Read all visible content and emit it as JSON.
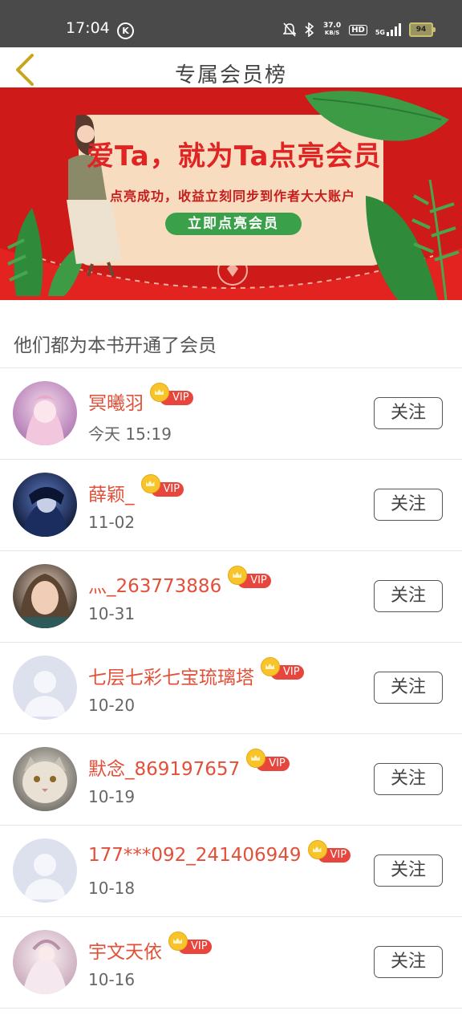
{
  "status_bar": {
    "time": "17:04",
    "k_icon_letter": "K",
    "net_speed_value": "37.0",
    "net_speed_unit": "KB/S",
    "hd_label": "HD",
    "signal_label": "5G",
    "battery": "94"
  },
  "nav": {
    "title": "专属会员榜"
  },
  "banner": {
    "title": "爱Ta，就为Ta点亮会员",
    "subtitle": "点亮成功，收益立刻同步到作者大大账户",
    "button": "立即点亮会员"
  },
  "section_title": "他们都为本书开通了会员",
  "members": [
    {
      "name": "冥曦羽",
      "date": "今天 15:19",
      "badge": "VIP",
      "follow": "关注",
      "avatar": "anime-pink"
    },
    {
      "name": "薛颖_",
      "date": "11-02",
      "badge": "VIP",
      "follow": "关注",
      "avatar": "anime-dark-blue"
    },
    {
      "name": "灬_263773886",
      "date": "10-31",
      "badge": "VIP",
      "follow": "关注",
      "avatar": "photo-girl"
    },
    {
      "name": "七层七彩七宝琉璃塔",
      "date": "10-20",
      "badge": "VIP",
      "follow": "关注",
      "avatar": "default-person"
    },
    {
      "name": "默念_869197657",
      "date": "10-19",
      "badge": "VIP",
      "follow": "关注",
      "avatar": "photo-cat"
    },
    {
      "name": "177***092_241406949",
      "date": "10-18",
      "badge": "VIP",
      "follow": "关注",
      "avatar": "default-person"
    },
    {
      "name": "宇文天依",
      "date": "10-16",
      "badge": "VIP",
      "follow": "关注",
      "avatar": "anime-white-dress"
    }
  ],
  "colors": {
    "accent_name": "#e2503a",
    "vip_badge": "#e8453c",
    "banner_red": "#cf1a1a",
    "back_arrow": "#c9a51d"
  }
}
